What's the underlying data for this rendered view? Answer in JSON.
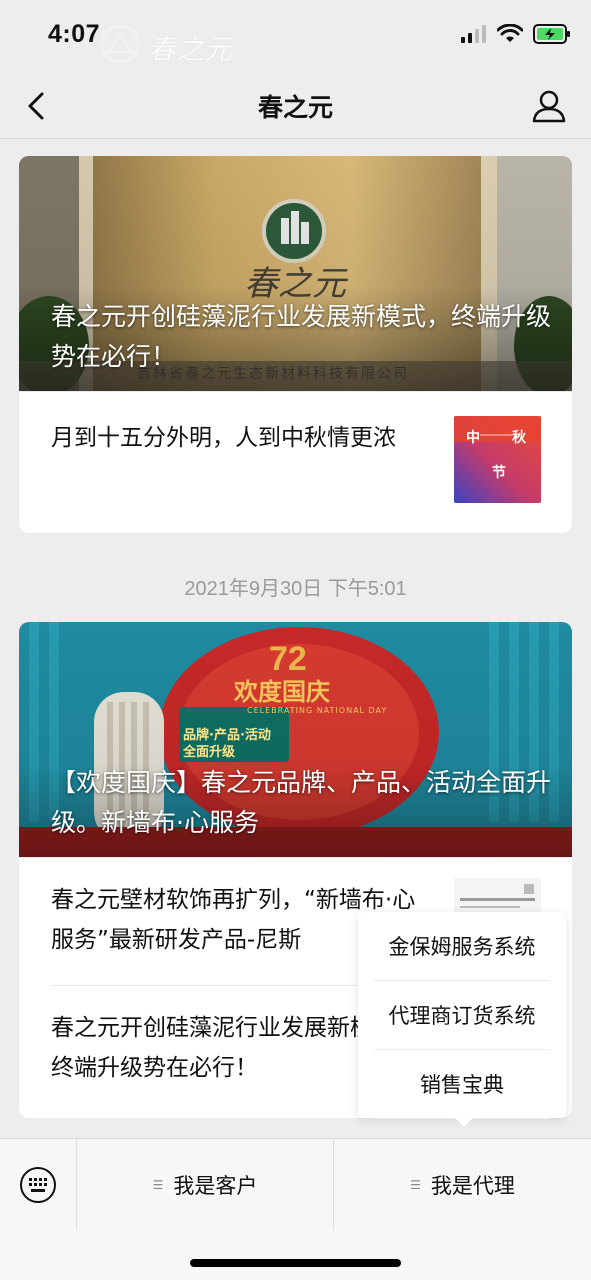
{
  "status_bar": {
    "time": "4:07",
    "watermark": "春之元"
  },
  "nav": {
    "title": "春之元"
  },
  "card1": {
    "hero_title": "春之元开创硅藻泥行业发展新模式，终端升级势在必行！",
    "sign_text": "春之元",
    "sign_sub": "吉林省春之元生态新材料科技有限公司",
    "sub_title": "月到十五分外明，人到中秋情更浓",
    "thumb": {
      "c1": "中",
      "c2": "秋",
      "c3": "节"
    }
  },
  "timestamp": "2021年9月30日 下午5:01",
  "card2": {
    "hero_title": "【欢度国庆】春之元品牌、产品、活动全面升级。新墙布·心服务",
    "hero_badge_number": "72",
    "hero_badge_text": "欢度国庆",
    "hero_badge_sub": "CELEBRATING NATIONAL DAY",
    "hero_panel": "品牌·产品·活动 全面升级",
    "items": [
      {
        "text": "春之元壁材软饰再扩列，“新墙布·心服务”最新研发产品-尼斯"
      },
      {
        "text": "春之元开创硅藻泥行业发展新模式，终端升级势在必行！"
      }
    ]
  },
  "popup": {
    "items": [
      "金保姆服务系统",
      "代理商订货系统",
      "销售宝典"
    ]
  },
  "bottom_menu": {
    "left": "我是客户",
    "right": "我是代理"
  },
  "icons": {
    "back": "chevron-left-icon",
    "profile": "person-icon",
    "keyboard": "keyboard-icon",
    "signal": "signal-icon",
    "wifi": "wifi-icon",
    "battery": "battery-charging-icon"
  },
  "colors": {
    "battery": "#4cd964",
    "timestamp": "#9a9a9a"
  }
}
